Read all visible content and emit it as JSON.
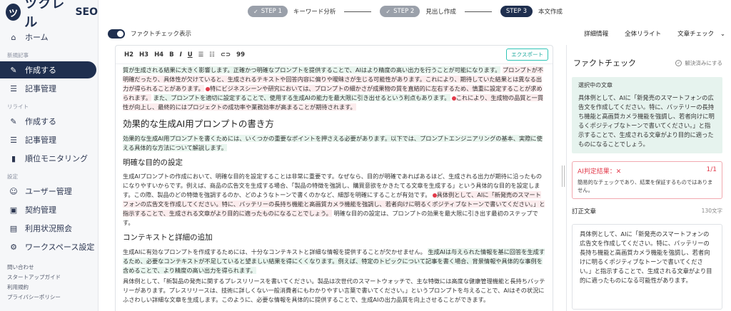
{
  "brand": {
    "mark": "ツ",
    "name": "ツクレル",
    "suffix": "SEO"
  },
  "sidebar": {
    "home": "ホーム",
    "section_new": "新規記事",
    "create": "作成する",
    "articles": "記事管理",
    "section_rewrite": "リライト",
    "rw_create": "作成する",
    "rw_articles": "記事管理",
    "rank": "順位モニタリング",
    "section_settings": "設定",
    "users": "ユーザー管理",
    "contract": "契約管理",
    "usage": "利用状況照会",
    "workspace": "ワークスペース設定",
    "footer": [
      "問い合わせ",
      "スタートアップガイド",
      "利用規約",
      "プライバシーポリシー"
    ]
  },
  "steps": [
    {
      "badge": "STEP 1",
      "label": "キーワード分析"
    },
    {
      "badge": "STEP 2",
      "label": "見出し作成"
    },
    {
      "badge": "STEP 3",
      "label": "本文作成"
    }
  ],
  "bar2": {
    "toggle_label": "ファクトチェック表示",
    "detail": "詳細情報",
    "rewrite_all": "全体リライト",
    "sentence_check": "文章チェック"
  },
  "toolbar": {
    "h2": "H2",
    "h3": "H3",
    "h4": "H4",
    "bold": "B",
    "italic": "I",
    "underline": "U",
    "ul": "☰",
    "ol": "☷",
    "link": "🔗",
    "quote": "99",
    "export": "エクスポート"
  },
  "content": {
    "p1a": "質が生成される結果に大きく影響します。正確かつ明確なプロンプトを提供することで、AIはより精度の高い出力を行うことが可能になります。",
    "p1b": "プロンプトが不明確だったり、具体性が欠けていると、生成されるテキストや回答内容に偏りや曖昧さが生じる可能性があります。これにより、期待していた結果とは異なる出力が得られることがあります。",
    "p1c": "特にビジネスシーンや研究においては、プロンプトの細かさが成果物の質を直結的に左右するため、慎重に設定することが求められます。",
    "p1d": "また、プロンプトを適切に設定することで、使用する生成AIの能力を最大限に引き出せるという利点もあります。",
    "p1e": "これにより、生成物の品質と一貫性が向上し、最終的にはプロジェクトの成功率や業務効率が高まることが期待されます。",
    "h2": "効果的な生成AI用プロンプトの書き方",
    "p2": "効果的な生成AI用プロンプトを書くためには、いくつかの重要なポイントを押さえる必要があります。以下では、プロンプトエンジニアリングの基本、実際に使える具体的な方法について解説します。",
    "h3a": "明確な目的の設定",
    "p3a": "生成AIプロンプトの作成において、明確な目的を設定することは非常に重要です。なぜなら、目的が明確であればあるほど、生成される出力が期待に沿ったものになりやすいからです。例えば、商品の広告文を生成する場合、「製品の特徴を強調し、購買意欲をかきたてる文章を生成する」という具体的な目的を設定します。この際、製品のどの特徴を強調するのか、どのようなトーンで書くのかなど、細部を明確にすることが有効です。",
    "p3b": "具体例として、AIに「新発売のスマートフォンの広告文を作成してください。特に、バッテリーの長持ち機能と高画質カメラ機能を強調し、若者向けに明るくポジティブなトーンで書いてください。」と指示することで、生成される文章がより目的に適ったものになることでしょう。",
    "p3c": "明確な目的の設定は、プロンプトの効果を最大限に引き出す最初のステップです。",
    "h3b": "コンテキストと詳細の追加",
    "p4a": "生成AIに有効なプロンプトを作成するためには、十分なコンテキストと詳細な情報を提供することが欠かせません。",
    "p4b": "生成AIは与えられた情報を基に回答を生成するため、必要なコンテキストが不足していると望ましい結果を得にくくなります。例えば、特定のトピックについて記事を書く場合、背景情報や具体的な事例を含めることで、より精度の高い出力を得られます。",
    "p4c": "具体例として、「新製品の発売に関するプレスリリースを書いてください。製品は次世代のスマートウォッチで、主な特徴には高度な健康管理機能と長持ちバッテリーがあります。プレスリリースは、技術に詳しくない一般消費者にもわかりやすい言葉で書いてください。」というプロンプトを与えることで、AIはその状況にふさわしい詳細な文章を生成します。このように、必要な情報を具体的に提供することで、生成AIの出力品質を向上させることができます。"
  },
  "panel": {
    "title": "ファクトチェック",
    "resolve": "解決済みにする",
    "selected_label": "選択中の文章",
    "selected_text": "具体例として、AIに「新発売のスマートフォンの広告文を作成してください。特に、バッテリーの長持ち機能と高画質カメラ機能を強調し、若者向けに明るくポジティブなトーンで書いてください。」と指示することで、生成される文章がより目的に適ったものになることでしょう。",
    "ai_result": "AI判定結果：✕",
    "ai_count": "1/1",
    "ai_note": "簡易的なチェックであり、結果を保証するものではありません。",
    "revised_label": "訂正文章",
    "revised_count": "130文字",
    "revised_text": "具体例として、AIに「新発売のスマートフォンの広告文を作成してください。特に、バッテリーの長持ち機能と高画質カメラ機能を強調し、若者向けに明るくポジティブなトーンで書いてください。」と指示することで、生成される文章がより目的に適ったものになる可能性があります。"
  }
}
